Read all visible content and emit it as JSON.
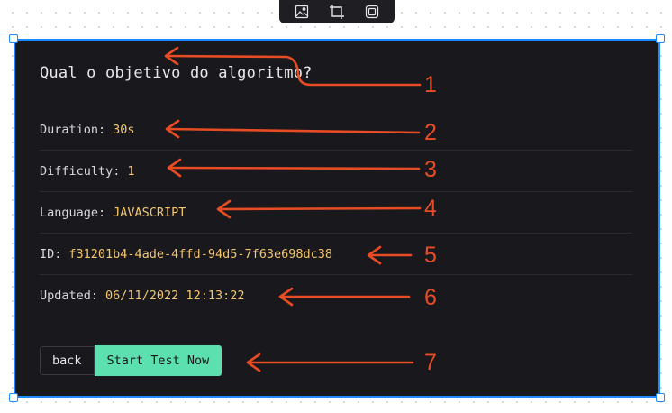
{
  "toolbar": {
    "icons": [
      "image-icon",
      "crop-icon",
      "frame-icon"
    ]
  },
  "card": {
    "question": "Qual o objetivo do algoritmo?",
    "fields": [
      {
        "label": "Duration:",
        "value": "30s"
      },
      {
        "label": "Difficulty:",
        "value": "1"
      },
      {
        "label": "Language:",
        "value": "JAVASCRIPT"
      },
      {
        "label": "ID:",
        "value": "f31201b4-4ade-4ffd-94d5-7f63e698dc38"
      },
      {
        "label": "Updated:",
        "value": "06/11/2022 12:13:22"
      }
    ],
    "back_label": "back",
    "start_label": "Start Test Now"
  },
  "annotations": {
    "numbers": [
      "1",
      "2",
      "3",
      "4",
      "5",
      "6",
      "7"
    ],
    "color": "#e84c24"
  },
  "colors": {
    "card_bg": "#19181d",
    "value_text": "#f2c66d",
    "start_button_bg": "#5ce0b0",
    "selection_border": "#1b8cff"
  }
}
